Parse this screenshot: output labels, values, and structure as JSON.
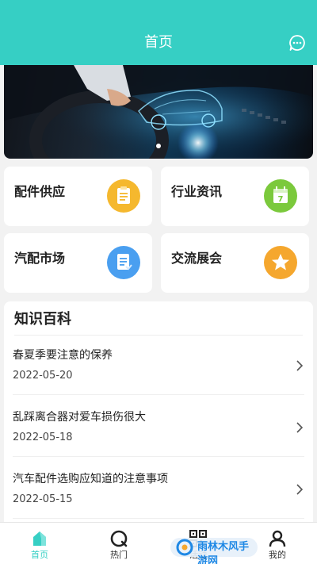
{
  "header": {
    "title": "首页"
  },
  "banner": {
    "alt": "car-tech-banner"
  },
  "cards": [
    {
      "label": "配件供应",
      "icon": "notepad-icon",
      "color": "#f5b82e"
    },
    {
      "label": "行业资讯",
      "icon": "calendar-icon",
      "color": "#7bc93c"
    },
    {
      "label": "汽配市场",
      "icon": "document-icon",
      "color": "#4a9ff0"
    },
    {
      "label": "交流展会",
      "icon": "star-icon",
      "color": "#f5a72e"
    }
  ],
  "knowledge": {
    "title": "知识百科",
    "articles": [
      {
        "title": "春夏季要注意的保养",
        "date": "2022-05-20"
      },
      {
        "title": "乱踩离合器对爱车损伤很大",
        "date": "2022-05-18"
      },
      {
        "title": "汽车配件选购应知道的注意事项",
        "date": "2022-05-15"
      }
    ]
  },
  "tabs": [
    {
      "label": "首页",
      "icon": "home-icon",
      "active": true
    },
    {
      "label": "热门",
      "icon": "search-icon",
      "active": false
    },
    {
      "label": "活动",
      "icon": "qrcode-icon",
      "active": false
    },
    {
      "label": "我的",
      "icon": "user-icon",
      "active": false
    }
  ],
  "watermark": {
    "text": "雨林木风手游网"
  },
  "colors": {
    "accent": "#36cfc4",
    "background": "#f2f2f2"
  }
}
